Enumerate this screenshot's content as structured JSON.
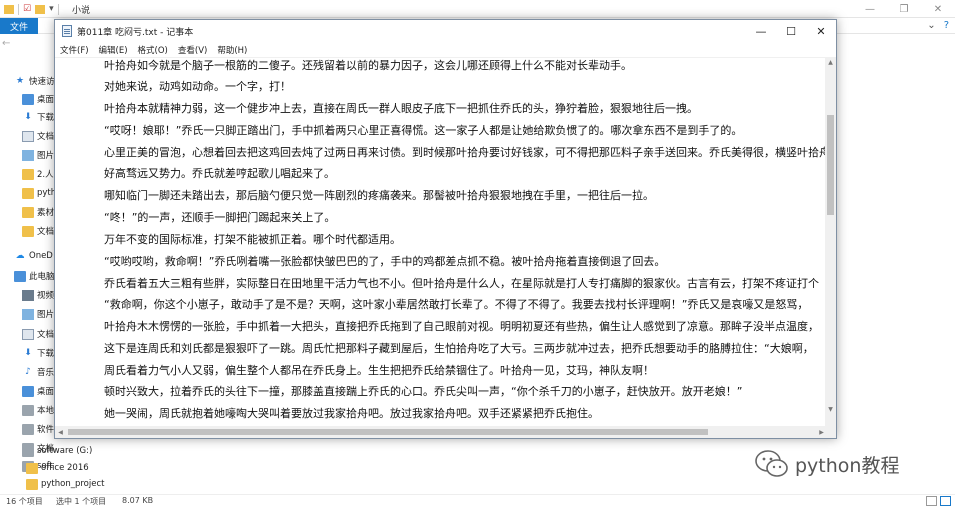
{
  "explorer": {
    "title": "小说",
    "file_tab": "文件",
    "nav_items": [
      {
        "label": "快速访",
        "icon": "star-icon"
      },
      {
        "label": "桌面",
        "icon": "desktop-icon"
      },
      {
        "label": "下载",
        "icon": "download-icon"
      },
      {
        "label": "文档",
        "icon": "document-icon"
      },
      {
        "label": "图片",
        "icon": "picture-icon"
      },
      {
        "label": "2.人",
        "icon": "folder-icon"
      },
      {
        "label": "pytho",
        "icon": "folder-icon"
      },
      {
        "label": "素材",
        "icon": "folder-icon"
      },
      {
        "label": "文档",
        "icon": "folder-icon"
      },
      {
        "label": "OneD",
        "icon": "onedrive-icon"
      },
      {
        "label": "此电脑",
        "icon": "computer-icon"
      },
      {
        "label": "视频",
        "icon": "video-icon"
      },
      {
        "label": "图片",
        "icon": "picture-icon"
      },
      {
        "label": "文档",
        "icon": "document-icon"
      },
      {
        "label": "下载",
        "icon": "download-icon"
      },
      {
        "label": "音乐",
        "icon": "music-icon"
      },
      {
        "label": "桌面",
        "icon": "desktop-icon"
      },
      {
        "label": "本地",
        "icon": "drive-icon"
      },
      {
        "label": "软件",
        "icon": "drive-icon"
      },
      {
        "label": "文档",
        "icon": "drive-icon"
      },
      {
        "label": "soft",
        "icon": "drive-icon"
      },
      {
        "label": "software (G:)",
        "icon": "drive-icon"
      },
      {
        "label": "office 2016",
        "icon": "folder-icon"
      },
      {
        "label": "python_project",
        "icon": "folder-icon"
      }
    ],
    "status": {
      "items": "16 个项目",
      "selected": "选中 1 个项目",
      "size": "8.07 KB"
    }
  },
  "watermark": {
    "text": "python教程"
  },
  "notepad": {
    "title": "第011章 吃闷亏.txt - 记事本",
    "menus": [
      "文件(F)",
      "编辑(E)",
      "格式(O)",
      "查看(V)",
      "帮助(H)"
    ],
    "lines": [
      "叶拾舟如今就是个脑子一根筋的二傻子。还残留着以前的暴力因子，这会儿哪还顾得上什么不能对长辈动手。",
      "对她来说，动鸡如动命。一个字，打！",
      "叶拾舟本就精神力弱，这一个健步冲上去，直接在周氏一群人眼皮子底下一把抓住乔氏的头，狰狞着脸，狠狠地往后一拽。",
      "“哎呀！娘耶！”乔氏一只脚正踏出门，手中抓着两只心里正喜得慌。这一家子人都是让她给欺负惯了的。哪次拿东西不是到手了的。",
      "心里正美的冒泡，心想着回去把这鸡回去炖了过两日再来讨债。到时候那叶拾舟要讨好钱家，可不得把那匹料子亲手送回来。乔氏美得很，横竖叶拾舟",
      "好高骛远又势力。乔氏就差哼起歌儿唱起来了。",
      "哪知临门一脚还未踏出去，那后脑勺便只觉一阵剧烈的疼痛袭来。那髻被叶拾舟狠狠地拽在手里，一把往后一拉。",
      "“咚！”的一声，还顺手一脚把门踢起来关上了。",
      "万年不变的国际标准，打架不能被抓正着。哪个时代都适用。",
      "“哎哟哎哟，救命啊！”乔氏咧着嘴一张脸都快皱巴巴的了，手中的鸡都差点抓不稳。被叶拾舟拖着直接倒退了回去。",
      "乔氏看着五大三粗有些胖，实际整日在田地里干活力气也不小。但叶拾舟是什么人，在星际就是打人专打痛脚的狠家伙。古言有云，打架不疼证打个",
      "“救命啊，你这个小崽子，敢动手了是不是？天啊，这叶家小辈居然敢打长辈了。不得了不得了。我要去找村长评理啊！”乔氏又是哀嚎又是怒骂，",
      "叶拾舟木木愣愣的一张脸，手中抓着一大把头，直接把乔氏拖到了自己眼前对视。明明初夏还有些热，偏生让人感觉到了凉意。那眸子没半点温度，",
      "这下是连周氏和刘氏都是狠狠吓了一跳。周氏忙把那料子藏到屋后，生怕拾舟吃了大亏。三两步就冲过去，把乔氏想要动手的胳膊拉住：“大娘啊，",
      "周氏看着力气小人又弱，偏生整个人都吊在乔氏身上。生生把把乔氏给禁锢住了。叶拾舟一见，艾玛，神队友啊！",
      "顿时兴致大，拉着乔氏的头往下一撞，那膝盖直接踹上乔氏的心口。乔氏尖叫一声，“你个杀千刀的小崽子，赶快放开。放开老娘！”",
      "她一哭闹，周氏就抱着她嚎啕大哭叫着要放过我家拾舟吧。放过我家拾舟吧。双手还紧紧把乔氏抱住。"
    ]
  }
}
